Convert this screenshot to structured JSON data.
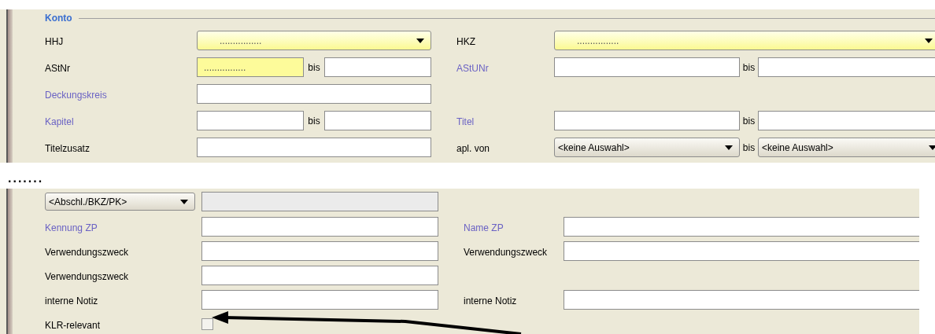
{
  "top_panel": {
    "legend": "Konto",
    "rows": [
      {
        "left": {
          "label": "HHJ",
          "linked": false,
          "fields": [
            {
              "kind": "combo",
              "value": "................",
              "highlighted": true
            }
          ]
        },
        "right": {
          "label": "HKZ",
          "linked": false,
          "fields": [
            {
              "kind": "combo",
              "value": "................",
              "highlighted": true
            }
          ]
        }
      },
      {
        "left": {
          "label": "AStNr",
          "linked": false,
          "fields": [
            {
              "kind": "text",
              "value": "................",
              "highlighted": true
            },
            {
              "kind": "text",
              "highlighted": false
            }
          ],
          "joiner": "bis"
        },
        "right": {
          "label": "AStUNr",
          "linked": true,
          "fields": [
            {
              "kind": "text",
              "highlighted": false
            },
            {
              "kind": "text",
              "highlighted": false
            }
          ],
          "joiner": "bis"
        }
      },
      {
        "left": {
          "label": "Deckungskreis",
          "linked": true,
          "fields": [
            {
              "kind": "text",
              "highlighted": false
            }
          ]
        }
      },
      {
        "left": {
          "label": "Kapitel",
          "linked": true,
          "fields": [
            {
              "kind": "text",
              "highlighted": false
            },
            {
              "kind": "text",
              "highlighted": false
            }
          ],
          "joiner": "bis"
        },
        "right": {
          "label": "Titel",
          "linked": true,
          "fields": [
            {
              "kind": "text",
              "highlighted": false
            },
            {
              "kind": "text",
              "highlighted": false
            }
          ],
          "joiner": "bis"
        }
      },
      {
        "left": {
          "label": "Titelzusatz",
          "linked": false,
          "fields": [
            {
              "kind": "text",
              "highlighted": false
            }
          ]
        },
        "right": {
          "label": "apl. von",
          "linked": false,
          "fields": [
            {
              "kind": "combo",
              "value": "<keine Auswahl>",
              "highlighted": false
            },
            {
              "kind": "combo",
              "value": "<keine Auswahl>",
              "highlighted": false
            }
          ],
          "joiner": "bis"
        }
      }
    ]
  },
  "separator": ".......",
  "bottom_panel": {
    "rows": [
      {
        "left": {
          "selector": "<Abschl./BKZ/PK>",
          "fields": [
            {
              "kind": "text",
              "disabled": true
            }
          ]
        }
      },
      {
        "left": {
          "label": "Kennung ZP",
          "linked": true,
          "fields": [
            {
              "kind": "text",
              "disabled": false
            }
          ]
        },
        "right": {
          "label": "Name ZP",
          "linked": true,
          "fields": [
            {
              "kind": "text",
              "disabled": false
            }
          ]
        }
      },
      {
        "left": {
          "label": "Verwendungszweck",
          "linked": false,
          "fields": [
            {
              "kind": "text",
              "disabled": false
            }
          ]
        },
        "right": {
          "label": "Verwendungszweck",
          "linked": false,
          "fields": [
            {
              "kind": "text",
              "disabled": false
            }
          ]
        }
      },
      {
        "left": {
          "label": "Verwendungszweck",
          "linked": false,
          "fields": [
            {
              "kind": "text",
              "disabled": false
            }
          ]
        }
      },
      {
        "left": {
          "label": "interne Notiz",
          "linked": false,
          "fields": [
            {
              "kind": "text",
              "disabled": false
            }
          ]
        },
        "right": {
          "label": "interne Notiz",
          "linked": false,
          "fields": [
            {
              "kind": "text",
              "disabled": false
            }
          ]
        }
      },
      {
        "left": {
          "label": "KLR-relevant",
          "linked": false,
          "fields": [
            {
              "kind": "checkbox",
              "checked": false
            }
          ]
        }
      }
    ]
  }
}
